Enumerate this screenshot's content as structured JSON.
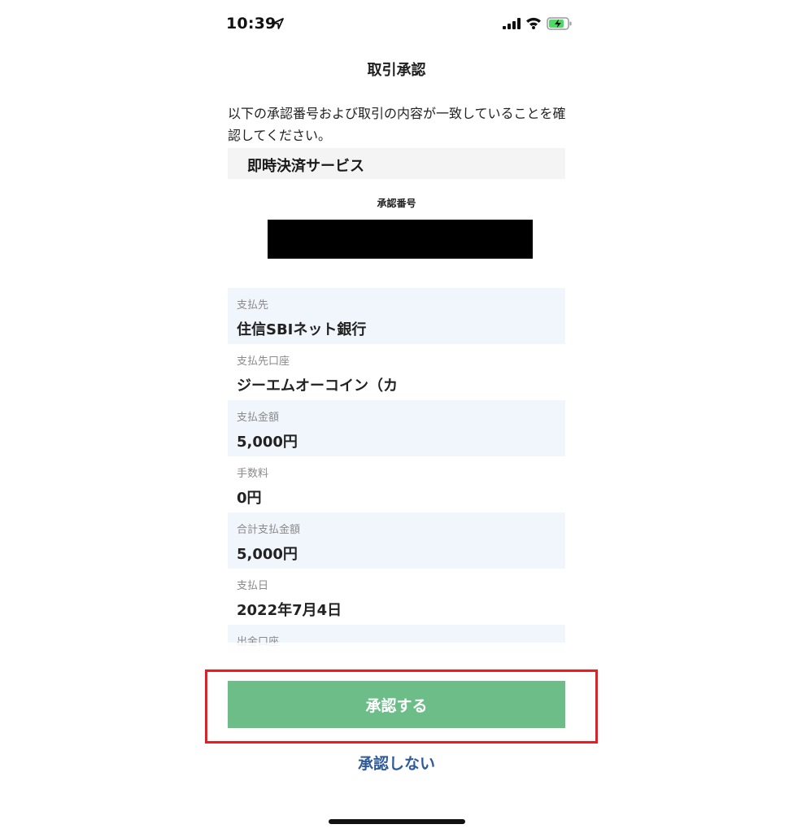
{
  "status_bar": {
    "time": "10:39"
  },
  "header": {
    "title": "取引承認"
  },
  "description": "以下の承認番号および取引の内容が一致していることを確認してください。",
  "service": {
    "name": "即時決済サービス"
  },
  "approval_number": {
    "label": "承認番号",
    "value": ""
  },
  "details": [
    {
      "label": "支払先",
      "value": "住信SBIネット銀行"
    },
    {
      "label": "支払先口座",
      "value": "ジーエムオーコイン（カ"
    },
    {
      "label": "支払金額",
      "value": "5,000円"
    },
    {
      "label": "手数料",
      "value": "0円"
    },
    {
      "label": "合計支払金額",
      "value": "5,000円"
    },
    {
      "label": "支払日",
      "value": "2022年7月4日"
    },
    {
      "label": "出金口座",
      "value": ""
    }
  ],
  "actions": {
    "approve_label": "承認する",
    "reject_label": "承認しない"
  },
  "colors": {
    "approve_bg": "#6cbd88",
    "link": "#2f5a9a",
    "highlight": "#e02025",
    "row_shade": "#f1f6fd"
  },
  "icons": [
    "location-arrow-icon",
    "signal-icon",
    "wifi-icon",
    "battery-charging-icon"
  ]
}
